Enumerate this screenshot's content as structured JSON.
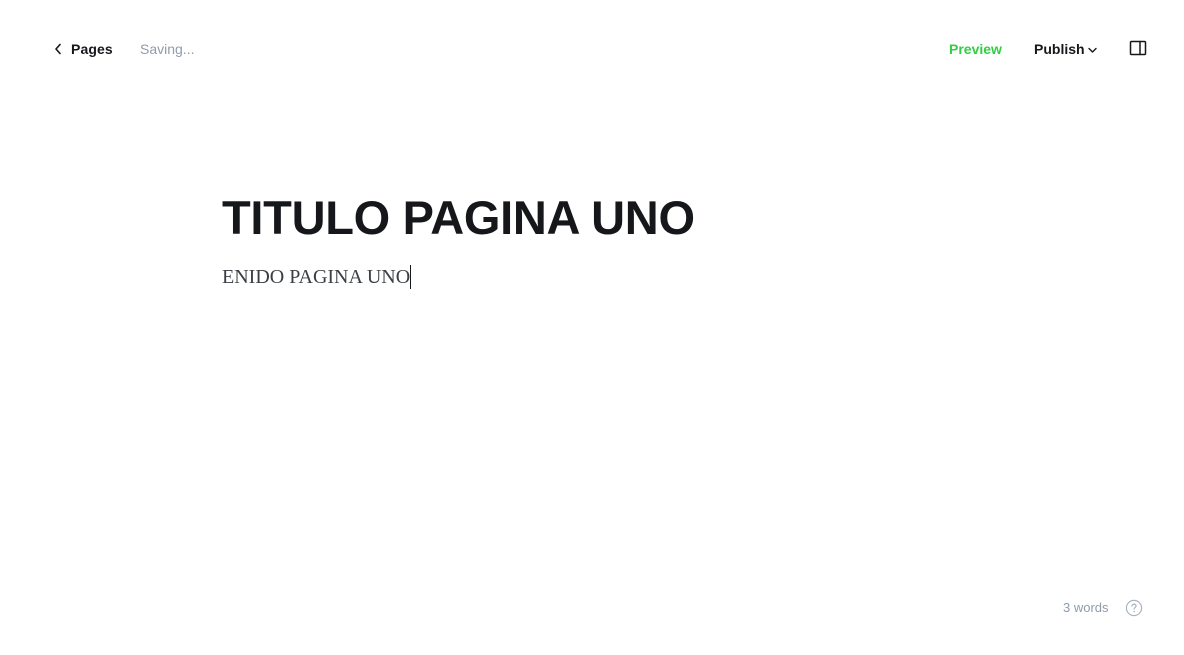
{
  "header": {
    "back_label": "Pages",
    "status_text": "Saving...",
    "preview_label": "Preview",
    "publish_label": "Publish",
    "icons": {
      "back": "chevron-left-icon",
      "publish_dropdown": "chevron-down-icon",
      "sidebar_toggle": "sidebar-panel-icon"
    }
  },
  "editor": {
    "title": "TITULO PAGINA UNO",
    "body": "ENIDO PAGINA UNO"
  },
  "footer": {
    "word_count": "3 words",
    "help_icon": "question-circle-icon"
  },
  "colors": {
    "accent": "#30cf43",
    "text": "#15171a",
    "muted": "#8e9cac"
  }
}
